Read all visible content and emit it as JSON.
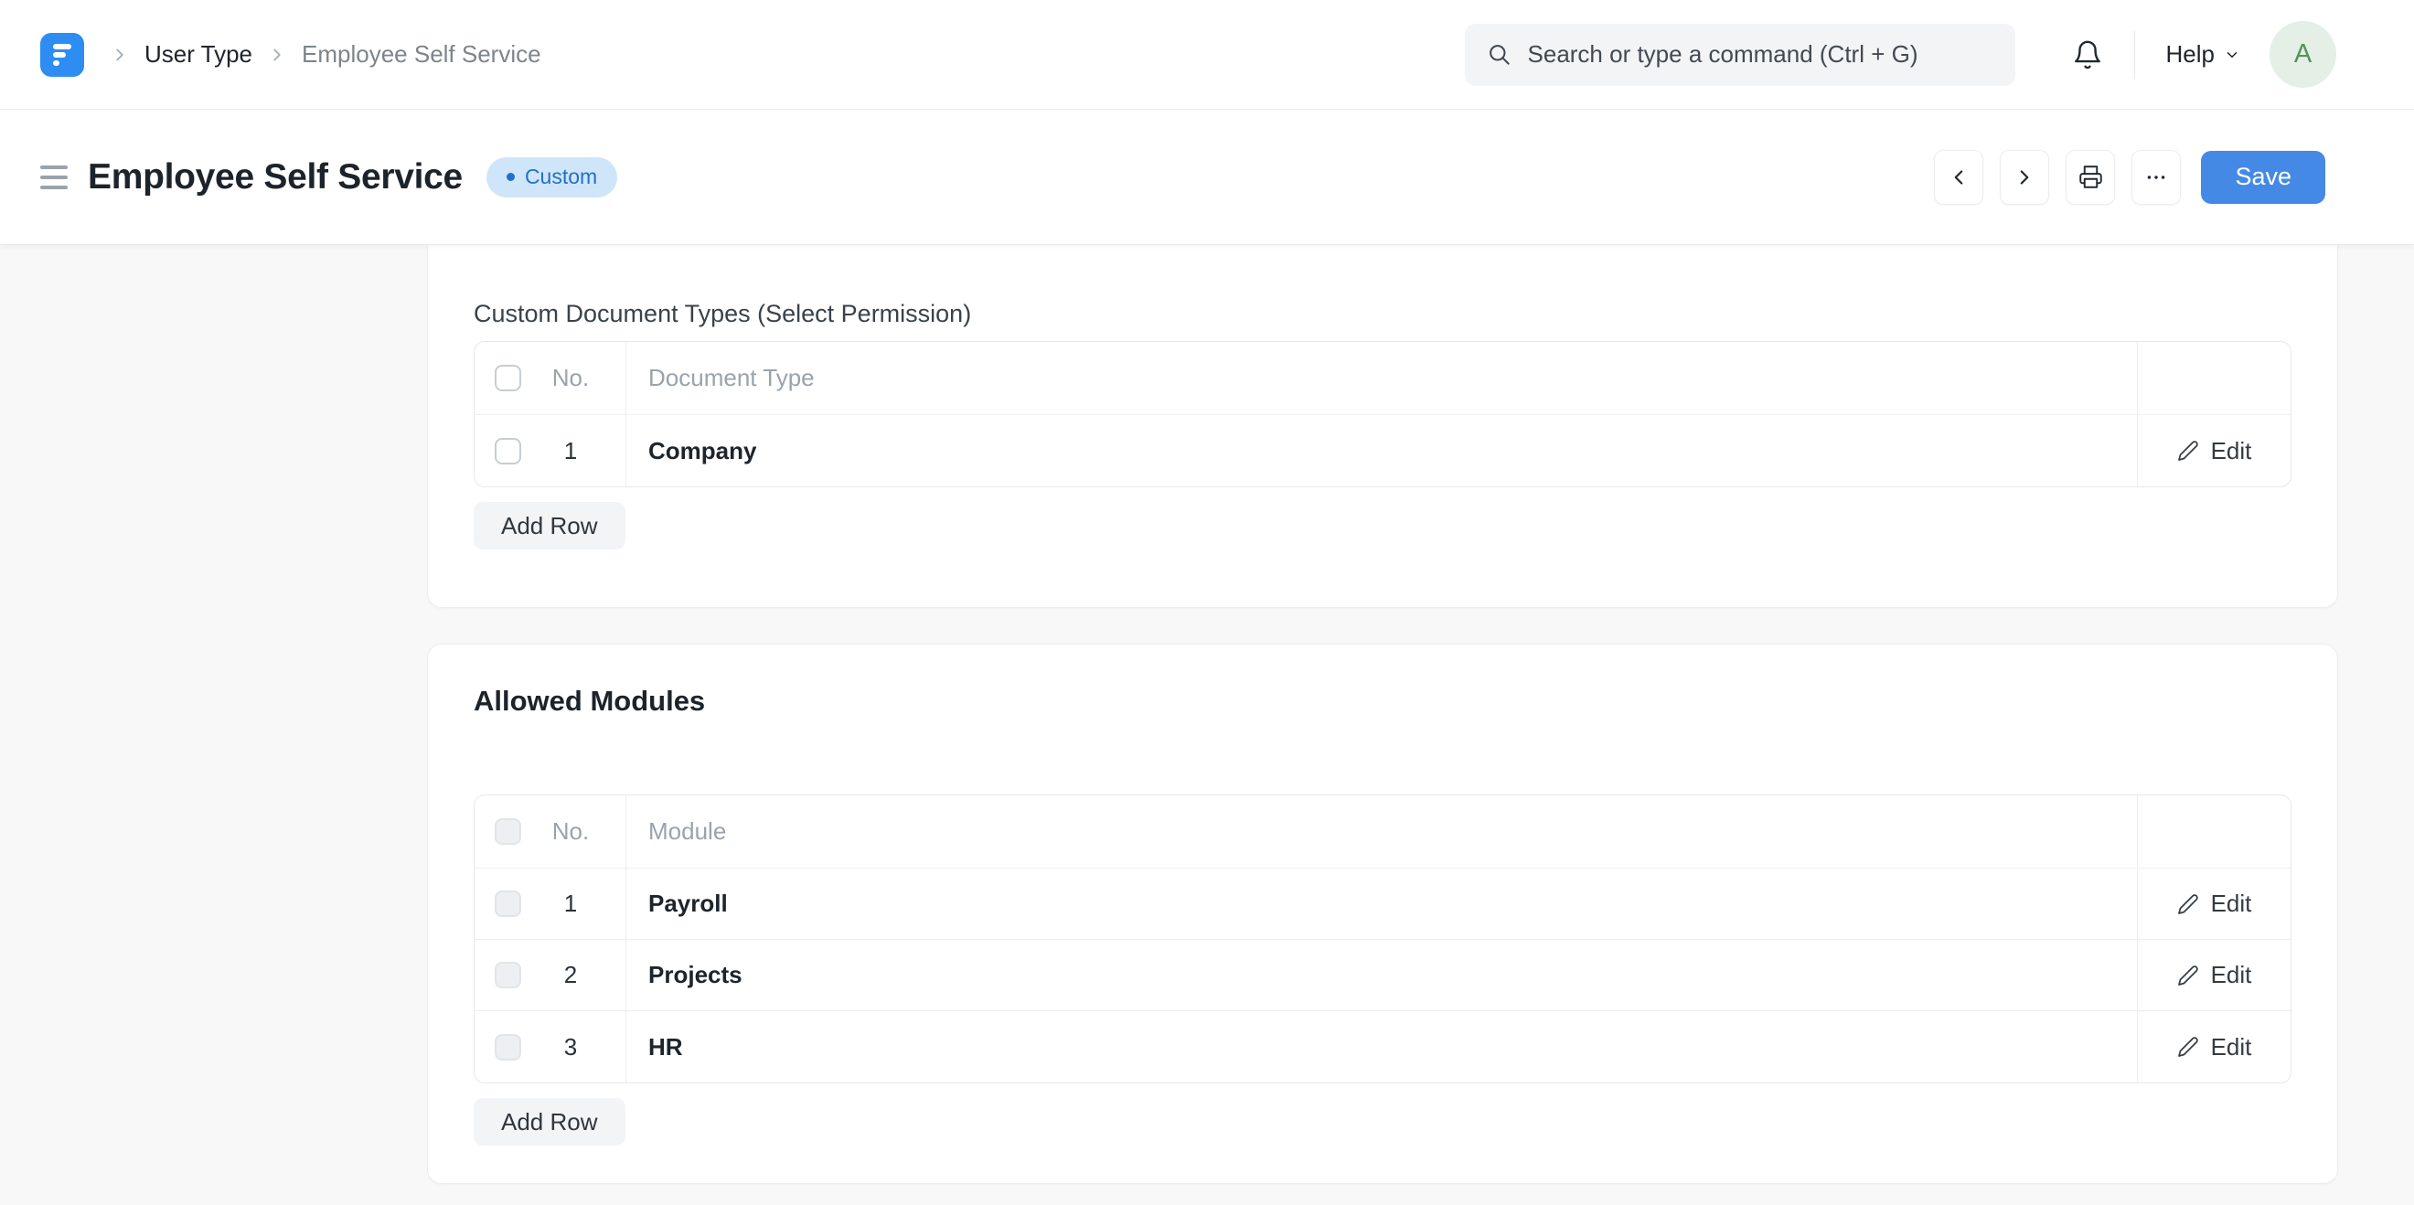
{
  "navbar": {
    "breadcrumb": [
      {
        "label": "User Type"
      },
      {
        "label": "Employee Self Service"
      }
    ],
    "search": {
      "placeholder": "Search or type a command (Ctrl + G)"
    },
    "help_label": "Help",
    "avatar_letter": "A"
  },
  "page_head": {
    "title": "Employee Self Service",
    "badge": "Custom",
    "save_label": "Save"
  },
  "sections": [
    {
      "label": "Custom Document Types (Select Permission)",
      "columns": [
        "No.",
        "Document Type"
      ],
      "rows": [
        {
          "no": "1",
          "value": "Company"
        }
      ],
      "edit_label": "Edit",
      "add_row_label": "Add Row",
      "checkboxes_disabled": false
    },
    {
      "heading": "Allowed Modules",
      "columns": [
        "No.",
        "Module"
      ],
      "rows": [
        {
          "no": "1",
          "value": "Payroll"
        },
        {
          "no": "2",
          "value": "Projects"
        },
        {
          "no": "3",
          "value": "HR"
        }
      ],
      "edit_label": "Edit",
      "add_row_label": "Add Row",
      "checkboxes_disabled": true
    }
  ],
  "colors": {
    "primary": "#4589e6",
    "logo_blue": "#2d8df2",
    "badge_bg": "#cfe5fa",
    "badge_text": "#2171c6",
    "avatar_bg": "#e4efe5",
    "avatar_text": "#55935a"
  }
}
